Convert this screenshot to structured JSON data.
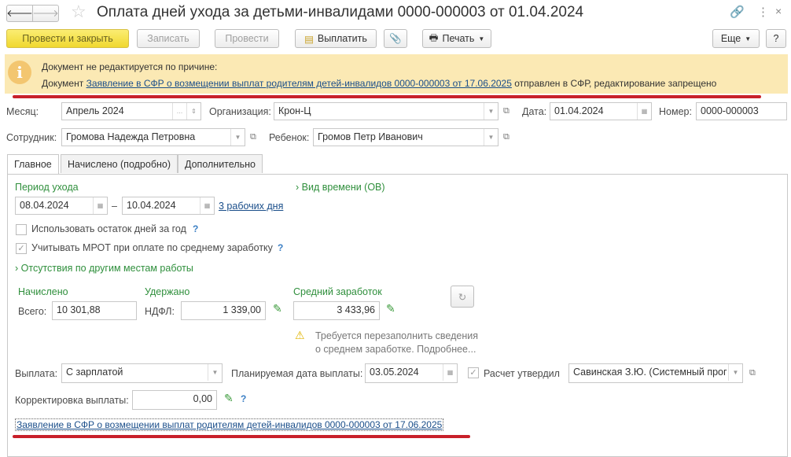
{
  "window": {
    "title": "Оплата дней ухода за детьми-инвалидами 0000-000003 от 01.04.2024",
    "back_icon": "arrow-left",
    "forward_icon": "arrow-right",
    "star_icon": "star",
    "link_icon": "link",
    "menu_icon": "more-vertical",
    "close_icon": "close"
  },
  "toolbar": {
    "post_close": "Провести и закрыть",
    "save": "Записать",
    "post": "Провести",
    "pay": "Выплатить",
    "print": "Печать",
    "more": "Еще",
    "help": "?"
  },
  "warning": {
    "line1": "Документ не редактируется по причине:",
    "prefix": "Документ ",
    "link": "Заявление в СФР о возмещении выплат родителям детей-инвалидов 0000-000003 от 17.06.2025",
    "suffix": " отправлен в СФР, редактирование запрещено",
    "bg": "#fbe9b4"
  },
  "header": {
    "month_label": "Месяц:",
    "month": "Апрель 2024",
    "org_label": "Организация:",
    "org": "Крон-Ц",
    "date_label": "Дата:",
    "date": "01.04.2024",
    "number_label": "Номер:",
    "number": "0000-000003",
    "employee_label": "Сотрудник:",
    "employee": "Громова Надежда Петровна",
    "child_label": "Ребенок:",
    "child": "Громов Петр Иванович"
  },
  "tabs": [
    {
      "label": "Главное",
      "active": true
    },
    {
      "label": "Начислено (подробно)"
    },
    {
      "label": "Дополнительно"
    }
  ],
  "main": {
    "period_label": "Период ухода",
    "from": "08.04.2024",
    "dash": "–",
    "to": "10.04.2024",
    "days_link": "3 рабочих дня",
    "time_type": "Вид времени (ОВ)",
    "use_remaining": "Использовать остаток дней за год",
    "use_remaining_checked": false,
    "mrot": "Учитывать МРОТ при оплате по среднему заработку",
    "mrot_checked": true,
    "other_jobs": "Отсутствия по другим местам работы",
    "accrued_label": "Начислено",
    "total_label": "Всего:",
    "total": "10 301,88",
    "withheld_label": "Удержано",
    "ndfl_label": "НДФЛ:",
    "ndfl": "1 339,00",
    "avg_label": "Средний заработок",
    "avg": "3 433,96",
    "avg_warning_1": "Требуется перезаполнить сведения",
    "avg_warning_2": "о среднем заработке. Подробнее...",
    "payment_label": "Выплата:",
    "payment": "С зарплатой",
    "planned_label": "Планируемая дата выплаты:",
    "planned": "03.05.2024",
    "approved_label": "Расчет утвердил",
    "approved_checked": true,
    "approver": "Савинская З.Ю. (Системный прог",
    "correction_label": "Корректировка выплаты:",
    "correction": "0,00",
    "sfr_link": "Заявление в СФР о возмещении выплат родителям детей-инвалидов 0000-000003 от 17.06.2025"
  },
  "accent": {
    "red_underline": "#c8202a",
    "green": "#2f8f3c",
    "link": "#1a4e8a"
  }
}
